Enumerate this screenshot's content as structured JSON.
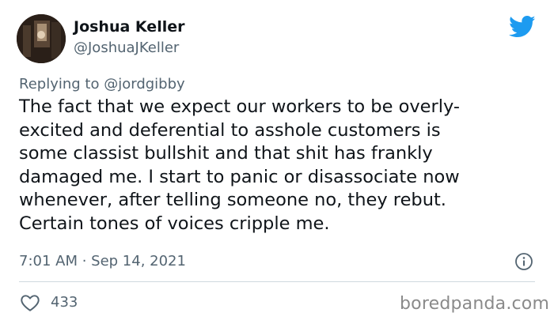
{
  "author": {
    "name": "Joshua Keller",
    "handle": "@JoshuaJKeller"
  },
  "reply": {
    "prefix": "Replying to",
    "mention": "@jordgibby"
  },
  "tweet": {
    "lines": [
      "The fact that we expect our workers to be overly-",
      "excited and deferential to asshole customers is",
      "some classist bullshit and that shit has frankly",
      "damaged me. I start to panic or disassociate now",
      "whenever, after telling someone no, they rebut.",
      "Certain tones of voices cripple me."
    ],
    "timestamp": "7:01 AM · Sep 14, 2021"
  },
  "engagement": {
    "likes": "433"
  },
  "icons": {
    "brand": "twitter-bird-icon",
    "info": "info-icon",
    "like": "heart-icon"
  },
  "colors": {
    "brand_blue": "#1d9bf0",
    "secondary_text": "#536471",
    "divider": "#cfd9de"
  },
  "watermark": "boredpanda.com"
}
